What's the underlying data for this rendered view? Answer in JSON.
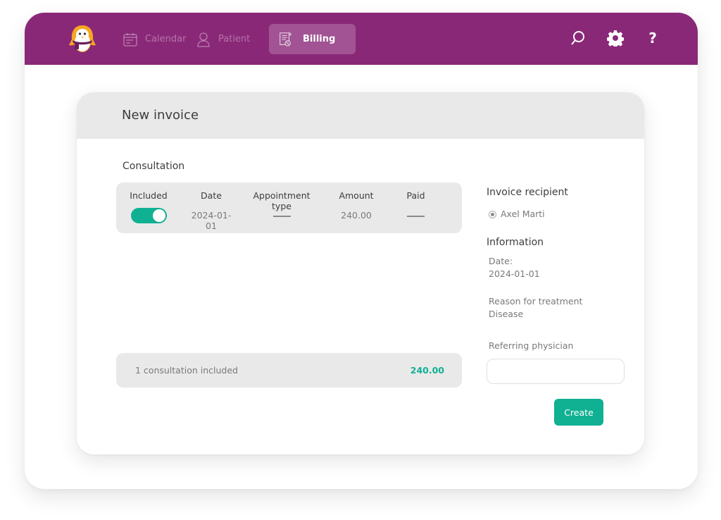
{
  "app": {
    "nav": [
      {
        "label": "Calendar",
        "icon": "calendar-icon",
        "active": false
      },
      {
        "label": "Patient",
        "icon": "user-icon",
        "active": false
      },
      {
        "label": "Billing",
        "icon": "invoice-icon",
        "active": true
      }
    ],
    "actions": {
      "search_icon": "search-icon",
      "settings_icon": "gear-icon",
      "help_label": "?"
    },
    "colors": {
      "brand": "#8a2878",
      "accent": "#10b093"
    }
  },
  "invoice": {
    "title": "New invoice",
    "consultation_section": "Consultation",
    "table": {
      "headers": [
        "Included",
        "Date",
        "Appointment type",
        "Amount",
        "Paid"
      ],
      "rows": [
        {
          "included": true,
          "date": "2024-01-01",
          "appointment_type": "—",
          "amount": "240.00",
          "paid": "—"
        }
      ]
    },
    "summary": {
      "text": "1 consultation included",
      "total": "240.00"
    },
    "recipient": {
      "title": "Invoice recipient",
      "name": "Axel Marti",
      "selected": true
    },
    "information": {
      "title": "Information",
      "date_label": "Date:",
      "date_value": "2024-01-01",
      "reason_label": "Reason for treatment",
      "reason_value": "Disease",
      "physician_label": "Referring physician",
      "physician_value": "",
      "physician_placeholder": ""
    },
    "create_label": "Create"
  }
}
